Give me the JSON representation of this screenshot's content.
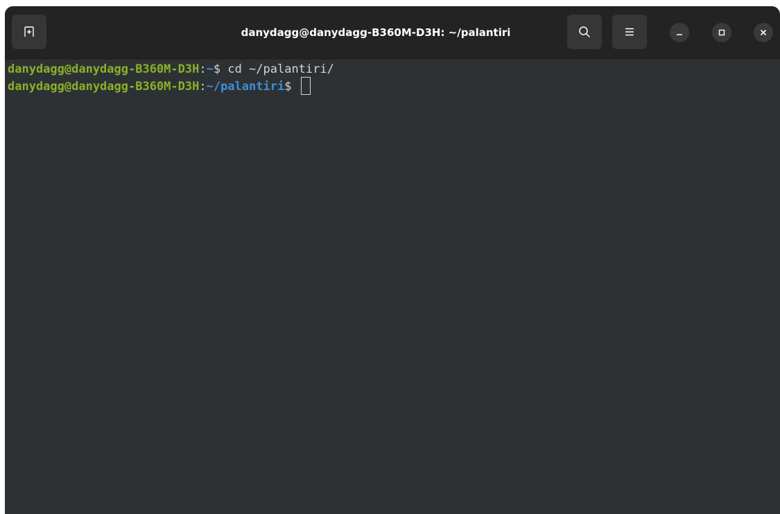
{
  "window": {
    "title": "danydagg@danydagg-B360M-D3H: ~/palantiri"
  },
  "header_buttons": {
    "new_tab_icon": "new-tab-icon",
    "search_icon": "search-icon",
    "menu_icon": "hamburger-menu-icon",
    "minimize_icon": "minimize-icon",
    "maximize_icon": "maximize-icon",
    "close_icon": "close-icon"
  },
  "terminal": {
    "lines": [
      {
        "user_host": "danydagg@danydagg-B360M-D3H",
        "sep": ":",
        "path": "~",
        "prompt": "$ ",
        "command": "cd ~/palantiri/"
      },
      {
        "user_host": "danydagg@danydagg-B360M-D3H",
        "sep": ":",
        "path": "~/palantiri",
        "prompt": "$ ",
        "command": ""
      }
    ]
  },
  "colors": {
    "background": "#2e3134",
    "titlebar": "#232323",
    "user_host": "#8ab226",
    "path": "#3d8fd6",
    "text": "#d3d7cf"
  }
}
